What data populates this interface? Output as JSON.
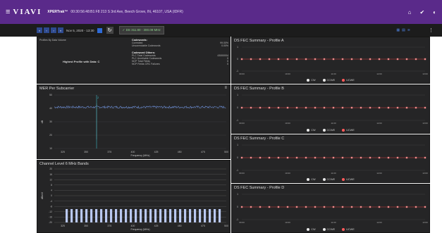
{
  "topbar": {
    "logo": "VIAVI",
    "product": "XPERTrak™",
    "device_info": "00:30:56:48:B1:F8  213 S 3rd Ave, Beech Grove, IN, 46107, USA  (IDFR)"
  },
  "toolbar": {
    "date": "Nov 5, 2020 - 13:30",
    "frequency": "DS 311.80 - 300.09 MHz",
    "nav_buttons": [
      "«",
      "‹",
      "›",
      "»"
    ]
  },
  "profiles_panel": {
    "title": "Profiles By Data Volume",
    "highest": "Highest Profile with Data: C",
    "codewords_title": "Codewords:",
    "codewords": [
      {
        "label": "Corrected",
        "value": "99.00%"
      },
      {
        "label": "Uncorrectable Codewords",
        "value": "0.00%"
      }
    ],
    "others_title": "Codeword Others:",
    "others": [
      {
        "label": "PLC Total Codewords",
        "value": "43000004"
      },
      {
        "label": "PLC Unreliable Codewords",
        "value": "0"
      },
      {
        "label": "NCP Total Fields",
        "value": "0"
      },
      {
        "label": "NCP Fields CRC Failures",
        "value": "0"
      }
    ]
  },
  "mer": {
    "title": "MER Per Subcarrier",
    "xlabel": "Frequency (MHz)",
    "ylabel": "dB",
    "yticks": [
      "50",
      "40",
      "30",
      "20",
      "10"
    ],
    "xticks": [
      "325",
      "350",
      "375",
      "400",
      "425",
      "450",
      "475",
      "500"
    ],
    "cursor_label": "2"
  },
  "channel": {
    "title": "Channel Level 6 MHz Bands",
    "xlabel": "Frequency (MHz)",
    "ylabel": "dBmV",
    "yticks": [
      "20",
      "16",
      "12",
      "8",
      "4",
      "0",
      "-4",
      "-8",
      "-12",
      "-16",
      "-20"
    ],
    "xticks": [
      "325",
      "350",
      "375",
      "400",
      "425",
      "450",
      "475",
      "500"
    ],
    "bar_count": 32,
    "bar_level": -18
  },
  "fec": {
    "profiles": [
      {
        "title": "DS FEC Summary - Profile A"
      },
      {
        "title": "DS FEC Summary - Profile B"
      },
      {
        "title": "DS FEC Summary - Profile C"
      },
      {
        "title": "DS FEC Summary - Profile D"
      }
    ],
    "yticks": [
      "1",
      "0",
      "-1"
    ],
    "xticks": [
      "09:00",
      "10:00",
      "11:00",
      "12:00",
      "13:00"
    ],
    "legend": [
      {
        "label": "CW",
        "color": "#e8e8e8"
      },
      {
        "label": "CCWE",
        "color": "#e8e8e8"
      },
      {
        "label": "UCWE",
        "color": "#ff5a5a"
      }
    ],
    "point_count": 21,
    "marker_color": "#f08a8a",
    "line_color": "#cc3333"
  },
  "colors": {
    "brand": "#5a2a8a",
    "mer_line": "#6d8fd6",
    "cursor": "#3fb6c4",
    "bar": "#b9c8f0"
  }
}
